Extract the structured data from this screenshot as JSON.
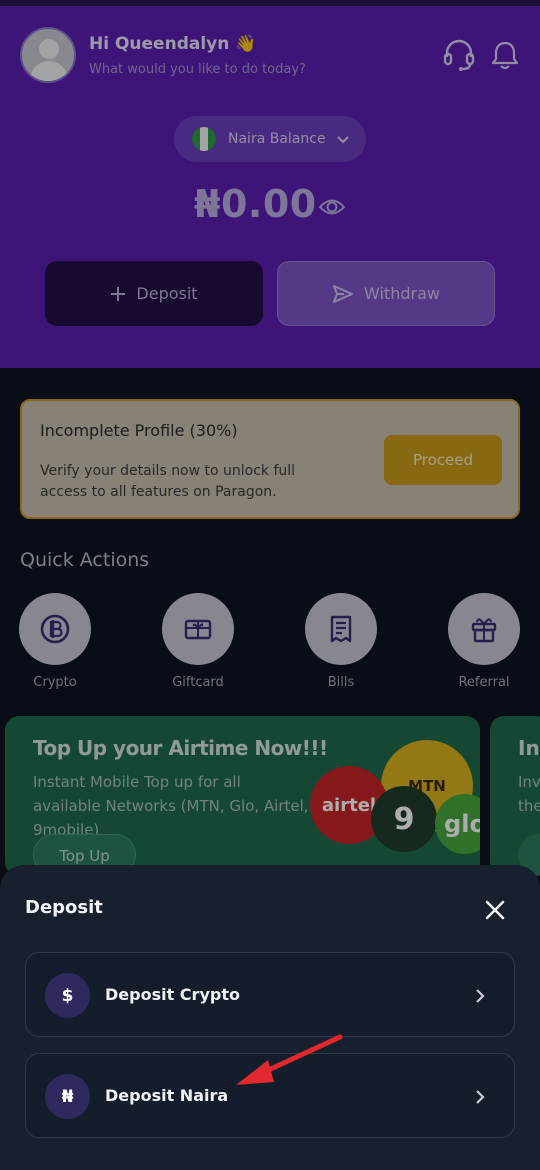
{
  "header": {
    "greeting": "Hi Queendalyn 👋",
    "subtitle": "What would you like to do today?",
    "balance_selector": "Naira Balance",
    "balance_amount": "₦0.00",
    "deposit_label": "Deposit",
    "withdraw_label": "Withdraw"
  },
  "profile_card": {
    "title": "Incomplete Profile (30%)",
    "text": "Verify your details now to unlock full access to all features on Paragon.",
    "button": "Proceed"
  },
  "quick_actions": {
    "title": "Quick Actions",
    "items": [
      {
        "label": "Crypto",
        "icon": "bitcoin-icon"
      },
      {
        "label": "Giftcard",
        "icon": "giftcard-icon"
      },
      {
        "label": "Bills",
        "icon": "receipt-icon"
      },
      {
        "label": "Referral",
        "icon": "gift-icon"
      }
    ]
  },
  "banner": {
    "title": "Top Up your Airtime Now!!!",
    "text": "Instant Mobile Top up for all available Networks (MTN, Glo, Airtel, 9mobile)",
    "button": "Top Up",
    "network_logos": [
      "airtel",
      "MTN",
      "9",
      "glo"
    ],
    "next_title": "Inv",
    "next_text": "Inv the"
  },
  "sheet": {
    "title": "Deposit",
    "options": [
      {
        "label": "Deposit Crypto",
        "icon_glyph": "$"
      },
      {
        "label": "Deposit Naira",
        "icon_glyph": "₦"
      }
    ]
  },
  "colors": {
    "header_purple": "#5b1fb3",
    "proceed_gold": "#c99a19",
    "banner_green": "#1f6a4a",
    "sheet_bg": "#16202f",
    "annotation_arrow": "#e0282e"
  }
}
